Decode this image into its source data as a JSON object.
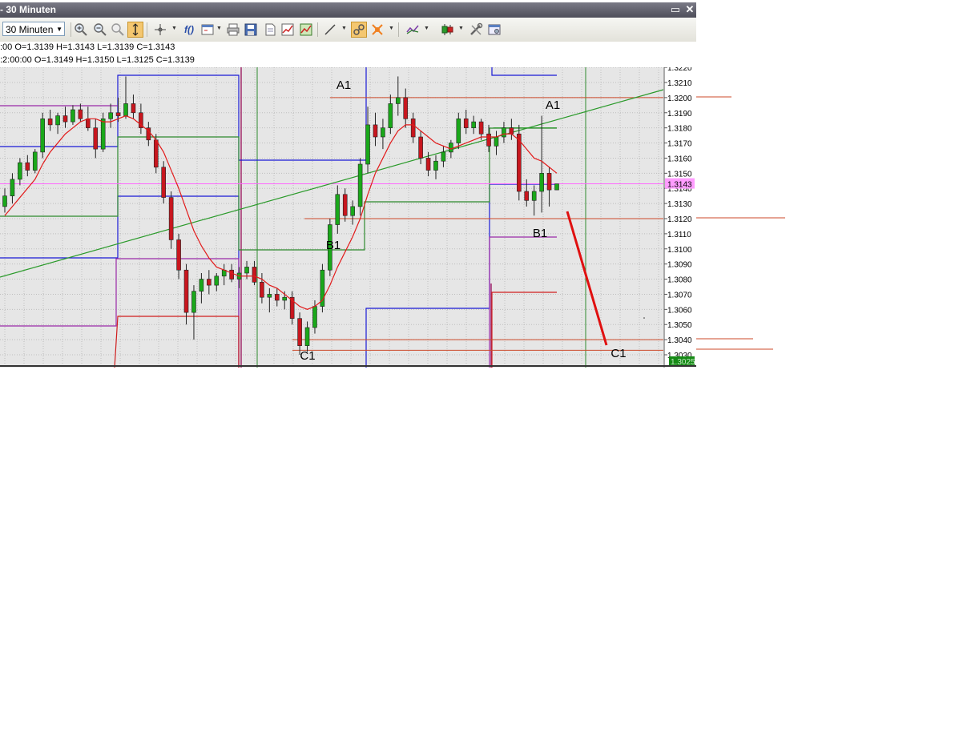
{
  "window": {
    "title": "- 30 Minuten",
    "minimize_glyph": "▭",
    "close_glyph": "✕"
  },
  "toolbar": {
    "timeframe_value": "30 Minuten",
    "icons": [
      "zoom-in-icon",
      "zoom-out-icon",
      "zoom-reset-icon",
      "autoscale-icon",
      "crosshair-icon",
      "function-icon",
      "template-icon",
      "print-icon",
      "save-icon",
      "page-icon",
      "chart-icon",
      "save-chart-icon",
      "draw-line-icon",
      "link-icon",
      "magnet-icon",
      "indicator-icon",
      "candle-style-icon",
      "tools-icon",
      "properties-icon"
    ]
  },
  "info": {
    "line1": ":00 O=1.3139 H=1.3143 L=1.3139 C=1.3143",
    "line2": ":2:00:00 O=1.3149 H=1.3150 L=1.3125 C=1.3139"
  },
  "chart_data": {
    "type": "candlestick",
    "price_axis": {
      "ticks": [
        "1.3220",
        "1.3210",
        "1.3200",
        "1.3190",
        "1.3180",
        "1.3170",
        "1.3160",
        "1.3150",
        "1.3140",
        "1.3130",
        "1.3120",
        "1.3110",
        "1.3100",
        "1.3090",
        "1.3080",
        "1.3070",
        "1.3060",
        "1.3050",
        "1.3040",
        "1.3030"
      ],
      "current_price": "1.3143",
      "bottom_label": "1.3025",
      "ylim": [
        1.3025,
        1.3222
      ]
    },
    "annotations": [
      {
        "text": "A1",
        "price": 1.321
      },
      {
        "text": "B1",
        "price": 1.3105
      },
      {
        "text": "C1",
        "price": 1.3029
      },
      {
        "text": "A1",
        "price": 1.3195
      },
      {
        "text": "B1",
        "price": 1.311
      },
      {
        "text": "C1",
        "price": 1.303
      }
    ],
    "horizontal_levels": [
      1.32,
      1.312,
      1.304,
      1.3033
    ],
    "colors": {
      "up": "#1aa81a",
      "down": "#c8161e",
      "ma": "#e21b1b",
      "trend": "#2a9a2a",
      "current": "#ff66ff",
      "level": "#cc4a2a",
      "blue": "#1a1ad6",
      "green_band": "#2e8a2e",
      "purple": "#9a2aa8",
      "red_band": "#d01e1e"
    },
    "candles": [
      {
        "o": 1.3128,
        "h": 1.314,
        "l": 1.3124,
        "c": 1.3135
      },
      {
        "o": 1.3135,
        "h": 1.315,
        "l": 1.313,
        "c": 1.3146
      },
      {
        "o": 1.3146,
        "h": 1.316,
        "l": 1.3142,
        "c": 1.3157
      },
      {
        "o": 1.3157,
        "h": 1.3162,
        "l": 1.3148,
        "c": 1.3152
      },
      {
        "o": 1.3152,
        "h": 1.3166,
        "l": 1.315,
        "c": 1.3164
      },
      {
        "o": 1.3164,
        "h": 1.319,
        "l": 1.316,
        "c": 1.3186
      },
      {
        "o": 1.3186,
        "h": 1.3192,
        "l": 1.3178,
        "c": 1.3182
      },
      {
        "o": 1.3182,
        "h": 1.319,
        "l": 1.3176,
        "c": 1.3188
      },
      {
        "o": 1.3188,
        "h": 1.3194,
        "l": 1.318,
        "c": 1.3184
      },
      {
        "o": 1.3184,
        "h": 1.3195,
        "l": 1.3182,
        "c": 1.3192
      },
      {
        "o": 1.3192,
        "h": 1.3196,
        "l": 1.3184,
        "c": 1.3186
      },
      {
        "o": 1.3186,
        "h": 1.3194,
        "l": 1.3178,
        "c": 1.318
      },
      {
        "o": 1.318,
        "h": 1.3186,
        "l": 1.316,
        "c": 1.3166
      },
      {
        "o": 1.3166,
        "h": 1.319,
        "l": 1.3164,
        "c": 1.3186
      },
      {
        "o": 1.3186,
        "h": 1.3196,
        "l": 1.318,
        "c": 1.319
      },
      {
        "o": 1.319,
        "h": 1.32,
        "l": 1.3184,
        "c": 1.3188
      },
      {
        "o": 1.3188,
        "h": 1.3214,
        "l": 1.3186,
        "c": 1.3196
      },
      {
        "o": 1.3196,
        "h": 1.3202,
        "l": 1.3186,
        "c": 1.319
      },
      {
        "o": 1.319,
        "h": 1.3196,
        "l": 1.3176,
        "c": 1.318
      },
      {
        "o": 1.318,
        "h": 1.3184,
        "l": 1.3168,
        "c": 1.3172
      },
      {
        "o": 1.3172,
        "h": 1.3176,
        "l": 1.315,
        "c": 1.3154
      },
      {
        "o": 1.3154,
        "h": 1.3158,
        "l": 1.313,
        "c": 1.3134
      },
      {
        "o": 1.3134,
        "h": 1.3138,
        "l": 1.31,
        "c": 1.3106
      },
      {
        "o": 1.3106,
        "h": 1.311,
        "l": 1.308,
        "c": 1.3086
      },
      {
        "o": 1.3086,
        "h": 1.309,
        "l": 1.305,
        "c": 1.3058
      },
      {
        "o": 1.3058,
        "h": 1.3076,
        "l": 1.304,
        "c": 1.3072
      },
      {
        "o": 1.3072,
        "h": 1.3084,
        "l": 1.3064,
        "c": 1.308
      },
      {
        "o": 1.308,
        "h": 1.3086,
        "l": 1.307,
        "c": 1.3076
      },
      {
        "o": 1.3076,
        "h": 1.3084,
        "l": 1.3072,
        "c": 1.3082
      },
      {
        "o": 1.3082,
        "h": 1.309,
        "l": 1.3076,
        "c": 1.3086
      },
      {
        "o": 1.3086,
        "h": 1.309,
        "l": 1.3078,
        "c": 1.308
      },
      {
        "o": 1.308,
        "h": 1.3088,
        "l": 1.3074,
        "c": 1.3084
      },
      {
        "o": 1.3084,
        "h": 1.3092,
        "l": 1.308,
        "c": 1.3088
      },
      {
        "o": 1.3088,
        "h": 1.3092,
        "l": 1.3076,
        "c": 1.3078
      },
      {
        "o": 1.3078,
        "h": 1.3084,
        "l": 1.3064,
        "c": 1.3068
      },
      {
        "o": 1.3068,
        "h": 1.3074,
        "l": 1.3058,
        "c": 1.307
      },
      {
        "o": 1.307,
        "h": 1.3074,
        "l": 1.3062,
        "c": 1.3066
      },
      {
        "o": 1.3066,
        "h": 1.3072,
        "l": 1.306,
        "c": 1.3068
      },
      {
        "o": 1.3068,
        "h": 1.3072,
        "l": 1.305,
        "c": 1.3054
      },
      {
        "o": 1.3054,
        "h": 1.3058,
        "l": 1.303,
        "c": 1.3036
      },
      {
        "o": 1.3036,
        "h": 1.3052,
        "l": 1.3032,
        "c": 1.3048
      },
      {
        "o": 1.3048,
        "h": 1.3066,
        "l": 1.3044,
        "c": 1.3062
      },
      {
        "o": 1.3062,
        "h": 1.309,
        "l": 1.3058,
        "c": 1.3086
      },
      {
        "o": 1.3086,
        "h": 1.312,
        "l": 1.3082,
        "c": 1.3116
      },
      {
        "o": 1.3116,
        "h": 1.3142,
        "l": 1.311,
        "c": 1.3136
      },
      {
        "o": 1.3136,
        "h": 1.314,
        "l": 1.3118,
        "c": 1.3122
      },
      {
        "o": 1.3122,
        "h": 1.3132,
        "l": 1.3116,
        "c": 1.3128
      },
      {
        "o": 1.3128,
        "h": 1.316,
        "l": 1.3122,
        "c": 1.3156
      },
      {
        "o": 1.3156,
        "h": 1.3194,
        "l": 1.315,
        "c": 1.3182
      },
      {
        "o": 1.3182,
        "h": 1.319,
        "l": 1.3168,
        "c": 1.3174
      },
      {
        "o": 1.3174,
        "h": 1.3186,
        "l": 1.3166,
        "c": 1.318
      },
      {
        "o": 1.318,
        "h": 1.3202,
        "l": 1.3176,
        "c": 1.3196
      },
      {
        "o": 1.3196,
        "h": 1.3214,
        "l": 1.3188,
        "c": 1.32
      },
      {
        "o": 1.32,
        "h": 1.3206,
        "l": 1.318,
        "c": 1.3186
      },
      {
        "o": 1.3186,
        "h": 1.319,
        "l": 1.317,
        "c": 1.3174
      },
      {
        "o": 1.3174,
        "h": 1.3178,
        "l": 1.3156,
        "c": 1.316
      },
      {
        "o": 1.316,
        "h": 1.3164,
        "l": 1.3148,
        "c": 1.3152
      },
      {
        "o": 1.3152,
        "h": 1.3162,
        "l": 1.3146,
        "c": 1.3158
      },
      {
        "o": 1.3158,
        "h": 1.3168,
        "l": 1.3154,
        "c": 1.3164
      },
      {
        "o": 1.3164,
        "h": 1.3172,
        "l": 1.316,
        "c": 1.317
      },
      {
        "o": 1.317,
        "h": 1.319,
        "l": 1.3166,
        "c": 1.3186
      },
      {
        "o": 1.3186,
        "h": 1.3192,
        "l": 1.3176,
        "c": 1.318
      },
      {
        "o": 1.318,
        "h": 1.3188,
        "l": 1.3176,
        "c": 1.3184
      },
      {
        "o": 1.3184,
        "h": 1.3186,
        "l": 1.3172,
        "c": 1.3176
      },
      {
        "o": 1.3176,
        "h": 1.3182,
        "l": 1.3164,
        "c": 1.3168
      },
      {
        "o": 1.3168,
        "h": 1.3178,
        "l": 1.3162,
        "c": 1.3174
      },
      {
        "o": 1.3174,
        "h": 1.3184,
        "l": 1.317,
        "c": 1.318
      },
      {
        "o": 1.318,
        "h": 1.3186,
        "l": 1.3172,
        "c": 1.3176
      },
      {
        "o": 1.3176,
        "h": 1.3182,
        "l": 1.3132,
        "c": 1.3138
      },
      {
        "o": 1.3138,
        "h": 1.3146,
        "l": 1.3128,
        "c": 1.3132
      },
      {
        "o": 1.3132,
        "h": 1.3142,
        "l": 1.3122,
        "c": 1.3138
      },
      {
        "o": 1.3138,
        "h": 1.3188,
        "l": 1.3124,
        "c": 1.315
      },
      {
        "o": 1.315,
        "h": 1.3154,
        "l": 1.3128,
        "c": 1.3139
      },
      {
        "o": 1.3139,
        "h": 1.3143,
        "l": 1.3139,
        "c": 1.3143
      }
    ],
    "moving_average": [
      1.3122,
      1.3128,
      1.3134,
      1.314,
      1.3146,
      1.3156,
      1.3164,
      1.317,
      1.3176,
      1.318,
      1.3184,
      1.3186,
      1.3186,
      1.3184,
      1.3184,
      1.3186,
      1.3188,
      1.3186,
      1.3182,
      1.3178,
      1.3172,
      1.3164,
      1.3152,
      1.314,
      1.3126,
      1.3112,
      1.3102,
      1.3094,
      1.3088,
      1.3086,
      1.3084,
      1.3082,
      1.3082,
      1.3082,
      1.308,
      1.3076,
      1.3074,
      1.307,
      1.3066,
      1.3062,
      1.306,
      1.3062,
      1.3066,
      1.3076,
      1.3088,
      1.3098,
      1.3108,
      1.312,
      1.3136,
      1.315,
      1.316,
      1.317,
      1.3178,
      1.3182,
      1.3182,
      1.3178,
      1.3174,
      1.317,
      1.3168,
      1.3166,
      1.3168,
      1.317,
      1.3172,
      1.3174,
      1.3174,
      1.3174,
      1.3176,
      1.3176,
      1.3172,
      1.3166,
      1.316,
      1.3158,
      1.3154,
      1.315
    ]
  }
}
